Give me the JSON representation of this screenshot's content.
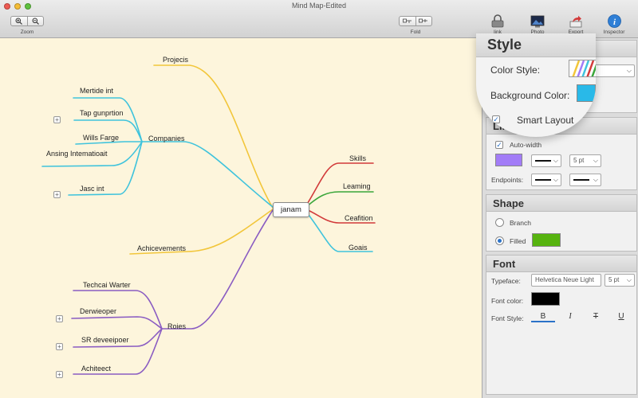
{
  "window": {
    "title": "Mind Map-Edited"
  },
  "toolbar": {
    "zoom_label": "Zoom",
    "fold_label": "Fold",
    "link_label": "link",
    "photo_label": "Photo",
    "export_label": "Export",
    "inspector_label": "Inspector",
    "icons": [
      "zoom-in-icon",
      "zoom-out-icon",
      "fold-icon",
      "unfold-icon",
      "link-icon",
      "photo-icon",
      "export-icon",
      "info-icon"
    ]
  },
  "mindmap": {
    "root": "janam",
    "nodes": {
      "projecis": "Projecis",
      "companies": "Companies",
      "mertide": "Mertide int",
      "tap": "Tap gunprtion",
      "wills": "Wills Farge",
      "ansing": "Ansing Intematioait",
      "jasc": "Jasc int",
      "achievements": "Achicevements",
      "roies": "Roies",
      "techcai": "Techcai Warter",
      "derwieoper": "Derwieoper",
      "sr": "SR deveeipoer",
      "achiteect": "Achiteect",
      "skills": "Skills",
      "leaming": "Leaming",
      "ceafition": "Ceafition",
      "goais": "Goais"
    },
    "colors": {
      "yellow": "#f2c63a",
      "cyan": "#3fc3dc",
      "purple": "#8a5cc2",
      "red": "#d23a3a",
      "green": "#3aa63a"
    },
    "collapse_glyph": "+"
  },
  "inspector": {
    "style": {
      "title": "Style",
      "color_style_label": "Color Style:",
      "background_color_label": "Background Color:",
      "smart_layout_label": "Smart Layout",
      "background_color": "#29b9e8"
    },
    "line": {
      "title": "Line",
      "auto_width_label": "Auto-width",
      "auto_width_checked": true,
      "line_color": "#a27cf7",
      "weight": "5 pt",
      "endpoints_label": "Endpoints:"
    },
    "shape": {
      "title": "Shape",
      "branch_label": "Branch",
      "filled_label": "Filled",
      "selected": "Filled",
      "fill_color": "#56b30f"
    },
    "font": {
      "title": "Font",
      "typeface_label": "Typeface:",
      "typeface": "Helvetica Neue Light",
      "size": "5 pt",
      "font_color_label": "Font color:",
      "font_color": "#000000",
      "font_style_label": "Font Style:",
      "bold": "B",
      "italic": "I",
      "strike": "T",
      "underline": "U"
    },
    "check_glyph": "✓",
    "chevron_glyph": "⌵"
  }
}
